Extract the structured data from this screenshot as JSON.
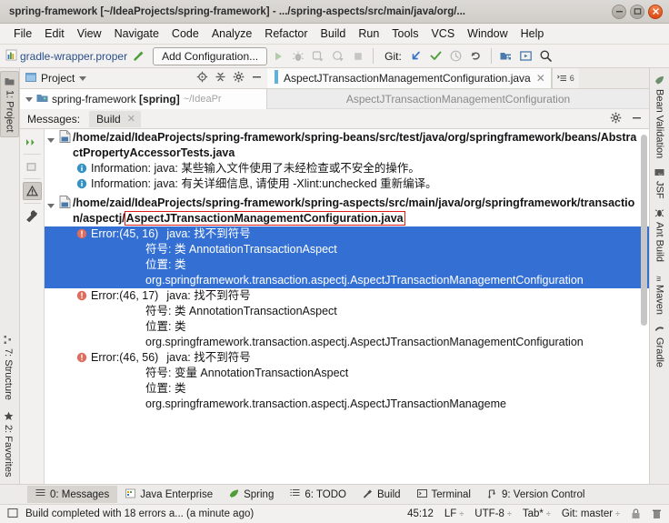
{
  "window": {
    "title": "spring-framework [~/IdeaProjects/spring-framework] - .../spring-aspects/src/main/java/org/...",
    "minimize_label": "–",
    "maximize_label": "▢",
    "close_label": "✕"
  },
  "menu": [
    {
      "label": "File",
      "mnemonic": "F"
    },
    {
      "label": "Edit",
      "mnemonic": "E"
    },
    {
      "label": "View",
      "mnemonic": "V"
    },
    {
      "label": "Navigate",
      "mnemonic": "N"
    },
    {
      "label": "Code",
      "mnemonic": "C"
    },
    {
      "label": "Analyze",
      "mnemonic": ""
    },
    {
      "label": "Refactor",
      "mnemonic": "R"
    },
    {
      "label": "Build",
      "mnemonic": "B"
    },
    {
      "label": "Run",
      "mnemonic": "u"
    },
    {
      "label": "Tools",
      "mnemonic": "T"
    },
    {
      "label": "VCS",
      "mnemonic": "S"
    },
    {
      "label": "Window",
      "mnemonic": "W"
    },
    {
      "label": "Help",
      "mnemonic": "H"
    }
  ],
  "toolbar": {
    "breadcrumb_file": "gradle-wrapper.proper",
    "run_config_label": "Add Configuration...",
    "git_label": "Git:",
    "icons": {
      "build": "hammer-icon",
      "run": "run-icon",
      "debug": "debug-icon",
      "run_coverage": "run-with-coverage-icon",
      "profile": "profile-icon",
      "stop": "stop-icon",
      "update_project": "git-update-icon",
      "commit": "git-commit-icon",
      "history": "git-history-icon",
      "rollback": "git-rollback-icon",
      "project_structure": "project-structure-icon",
      "preview": "preview-icon",
      "search_everywhere": "search-icon"
    }
  },
  "left_tool_tabs": [
    {
      "label": "1: Project",
      "mnemonic": "1",
      "icon": "project-folder-icon",
      "active": true
    },
    {
      "label": "7: Structure",
      "mnemonic": "7",
      "icon": "structure-icon",
      "active": false
    },
    {
      "label": "2: Favorites",
      "mnemonic": "2",
      "icon": "star-icon",
      "active": false
    }
  ],
  "right_tool_tabs": [
    {
      "label": "Bean Validation",
      "icon": "bean-validation-icon"
    },
    {
      "label": "JSF",
      "icon": "jsf-icon"
    },
    {
      "label": "Ant Build",
      "icon": "ant-icon"
    },
    {
      "label": "Maven",
      "icon": "maven-icon"
    },
    {
      "label": "Gradle",
      "icon": "gradle-icon"
    }
  ],
  "project_panel": {
    "title": "Project",
    "dropdown_caret": "▾",
    "icons": [
      "locate-icon",
      "collapse-all-icon",
      "settings-gear-icon",
      "hide-icon"
    ],
    "tree_root": {
      "name": "spring-framework ",
      "module": "[spring]",
      "path": "~/IdeaPr"
    }
  },
  "editor": {
    "tab_name": "AspectJTransactionManagementConfiguration.java",
    "tab_close": "✕",
    "tab_counter": "6",
    "breadcrumb": "AspectJTransactionManagementConfiguration"
  },
  "messages_panel": {
    "label": "Messages:",
    "tab": "Build",
    "tab_close": "✕",
    "settings_icon": "settings-gear-icon",
    "hide_icon": "hide-icon",
    "gutter_icons": [
      {
        "name": "expand-all-icon",
        "selected": false
      },
      {
        "name": "collapse-all-icon",
        "selected": false
      },
      {
        "name": "filter-warnings-icon",
        "selected": true
      },
      {
        "name": "build-settings-wrench-icon",
        "selected": false
      }
    ],
    "groups": [
      {
        "file_path": "/home/zaid/IdeaProjects/spring-framework/spring-beans/src/test/java/org/springframework/beans/AbstractPropertyAccessorTests.java",
        "highlighted_segment": "",
        "expanded": true,
        "messages": [
          {
            "severity": "information",
            "label": "Information: java: 某些输入文件使用了未经检查或不安全的操作。",
            "selected": false
          },
          {
            "severity": "information",
            "label": "Information: java: 有关详细信息, 请使用 -Xlint:unchecked 重新编译。",
            "selected": false
          }
        ]
      },
      {
        "file_path_prefix": "/home/zaid/IdeaProjects/spring-framework/spring-aspects/src/main/java/org/springframework/transaction/aspectj/",
        "file_path_highlight": "AspectJTransactionManagementConfiguration.java",
        "expanded": true,
        "errors": [
          {
            "severity": "error",
            "location": "Error:(45, 16)",
            "summary": "java: 找不到符号",
            "symbol_line": "符号:  类 AnnotationTransactionAspect",
            "location_label": "位置: 类",
            "location_value": "org.springframework.transaction.aspectj.AspectJTransactionManagementConfiguration",
            "selected": true
          },
          {
            "severity": "error",
            "location": "Error:(46, 17)",
            "summary": "java: 找不到符号",
            "symbol_line": "符号:  类 AnnotationTransactionAspect",
            "location_label": "位置: 类",
            "location_value": "org.springframework.transaction.aspectj.AspectJTransactionManagementConfiguration",
            "selected": false
          },
          {
            "severity": "error",
            "location": "Error:(46, 56)",
            "summary": "java: 找不到符号",
            "symbol_line": "符号:  变量 AnnotationTransactionAspect",
            "location_label": "位置: 类",
            "location_value": "org.springframework.transaction.aspectj.AspectJTransactionManageme",
            "selected": false
          }
        ]
      }
    ]
  },
  "bottom_tabs": [
    {
      "label": "0: Messages",
      "mnemonic": "0",
      "icon": "messages-icon",
      "active": true
    },
    {
      "label": "Java Enterprise",
      "mnemonic": "",
      "icon": "java-enterprise-icon",
      "active": false
    },
    {
      "label": "Spring",
      "mnemonic": "",
      "icon": "spring-leaf-icon",
      "active": false
    },
    {
      "label": "6: TODO",
      "mnemonic": "6",
      "icon": "todo-icon",
      "active": false
    },
    {
      "label": "Build",
      "mnemonic": "",
      "icon": "build-hammer-icon",
      "active": false
    },
    {
      "label": "Terminal",
      "mnemonic": "",
      "icon": "terminal-icon",
      "active": false
    },
    {
      "label": "9: Version Control",
      "mnemonic": "9",
      "icon": "version-control-icon",
      "active": false
    }
  ],
  "status_bar": {
    "toggle_icon": "toolwindow-toggle-icon",
    "message": "Build completed with 18 errors a... (a minute ago)",
    "caret_position": "45:12",
    "line_separator": "LF",
    "encoding": "UTF-8",
    "indent": "Tab*",
    "branch": "Git: master",
    "lock_icon": "lock-icon",
    "trash_icon": "trash-icon",
    "caret_glyph": "÷"
  },
  "colors": {
    "selection_blue": "#3470d4",
    "error_red": "#e06c5e",
    "info_blue": "#3592c4",
    "highlight_box_red": "#e01b1b",
    "link_blue": "#2b4f8a",
    "git_check_green": "#4f9d3a",
    "git_arrow_blue": "#3b73c4",
    "close_button_orange": "#dd4814"
  }
}
